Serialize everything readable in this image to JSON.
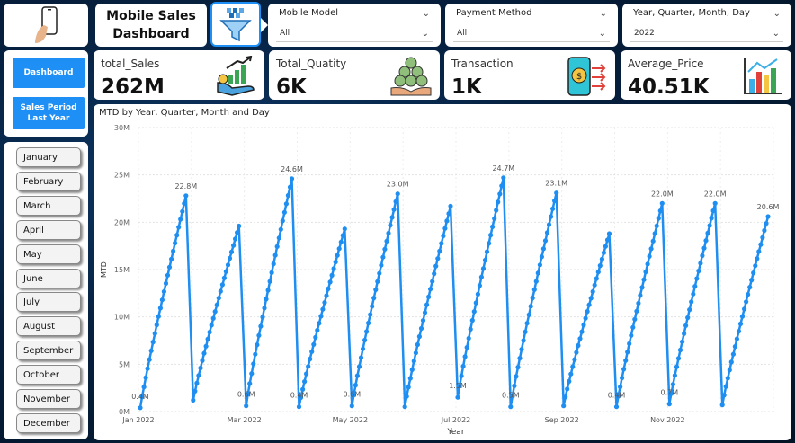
{
  "header": {
    "title_line1": "Mobile Sales",
    "title_line2": "Dashboard"
  },
  "slicers": [
    {
      "label": "Mobile Model",
      "value": "All"
    },
    {
      "label": "Payment Method",
      "value": "All"
    },
    {
      "label": "Year, Quarter, Month, Day",
      "value": "2022"
    }
  ],
  "kpis": [
    {
      "label": "total_Sales",
      "value": "262M",
      "icon": "money-growth-icon"
    },
    {
      "label": "Total_Quatity",
      "value": "6K",
      "icon": "coins-hand-icon"
    },
    {
      "label": "Transaction",
      "value": "1K",
      "icon": "phone-payment-icon"
    },
    {
      "label": "Average_Price",
      "value": "40.51K",
      "icon": "bar-chart-icon"
    }
  ],
  "nav": {
    "dashboard": "Dashboard",
    "sales_period": "Sales Period Last Year"
  },
  "months": [
    "January",
    "February",
    "March",
    "April",
    "May",
    "June",
    "July",
    "August",
    "September",
    "October",
    "November",
    "December"
  ],
  "colors": {
    "accent": "#1e8ff5",
    "line": "#1f8ef1"
  },
  "chart_data": {
    "type": "line",
    "title": "MTD by Year, Quarter, Month and Day",
    "xlabel": "Year",
    "ylabel": "MTD",
    "ylim": [
      0,
      30
    ],
    "y_unit": "M",
    "yticks": [
      "0M",
      "5M",
      "10M",
      "15M",
      "20M",
      "25M",
      "30M"
    ],
    "xticks": [
      "Jan 2022",
      "Mar 2022",
      "May 2022",
      "Jul 2022",
      "Sep 2022",
      "Nov 2022"
    ],
    "grid": true,
    "months": [
      {
        "month": "Jan",
        "start": 0.4,
        "end": 22.8,
        "start_label": "0.4M",
        "end_label": "22.8M"
      },
      {
        "month": "Feb",
        "start": 1.2,
        "end": 19.6,
        "start_label": "",
        "end_label": ""
      },
      {
        "month": "Mar",
        "start": 0.6,
        "end": 24.6,
        "start_label": "0.6M",
        "end_label": "24.6M"
      },
      {
        "month": "Apr",
        "start": 0.5,
        "end": 19.3,
        "start_label": "0.4M",
        "end_label": ""
      },
      {
        "month": "May",
        "start": 0.6,
        "end": 23.0,
        "start_label": "0.6M",
        "end_label": "23.0M"
      },
      {
        "month": "Jun",
        "start": 0.5,
        "end": 21.7,
        "start_label": "",
        "end_label": ""
      },
      {
        "month": "Jul",
        "start": 1.5,
        "end": 24.7,
        "start_label": "1.5M",
        "end_label": "24.7M"
      },
      {
        "month": "Aug",
        "start": 0.5,
        "end": 23.1,
        "start_label": "0.5M",
        "end_label": "23.1M"
      },
      {
        "month": "Sep",
        "start": 0.6,
        "end": 18.8,
        "start_label": "",
        "end_label": ""
      },
      {
        "month": "Oct",
        "start": 0.5,
        "end": 22.0,
        "start_label": "0.4M",
        "end_label": "22.0M"
      },
      {
        "month": "Nov",
        "start": 0.8,
        "end": 22.0,
        "start_label": "0.7M",
        "end_label": "22.0M"
      },
      {
        "month": "Dec",
        "start": 0.7,
        "end": 20.6,
        "start_label": "",
        "end_label": "20.6M"
      }
    ]
  }
}
